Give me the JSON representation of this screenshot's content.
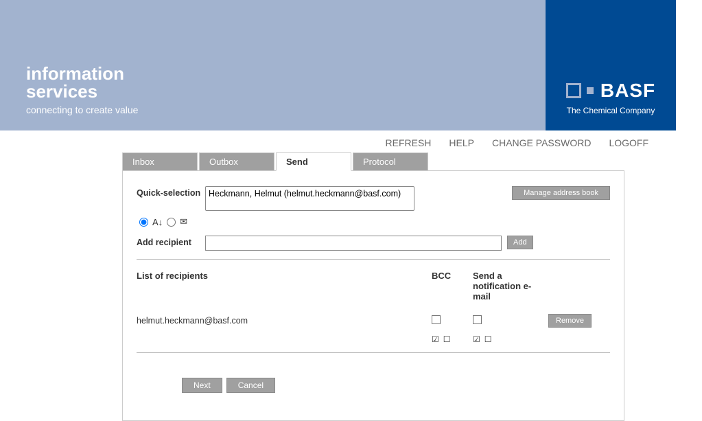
{
  "header": {
    "logo_line1a": "information",
    "logo_line1b": "services",
    "logo_tagline": "connecting to create value",
    "brand": "BASF",
    "brand_tagline": "The Chemical Company"
  },
  "topnav": {
    "refresh": "REFRESH",
    "help": "HELP",
    "change_password": "CHANGE PASSWORD",
    "logoff": "LOGOFF"
  },
  "tabs": {
    "inbox": "Inbox",
    "outbox": "Outbox",
    "send": "Send",
    "protocol": "Protocol"
  },
  "panel": {
    "quick_label": "Quick-selection",
    "quick_option": "Heckmann, Helmut (helmut.heckmann@basf.com)",
    "manage_btn": "Manage address book",
    "add_label": "Add recipient",
    "add_btn": "Add",
    "list_header": "List of recipients",
    "bcc_header": "BCC",
    "notif_header": "Send a notification e-mail",
    "recipient_email": "helmut.heckmann@basf.com",
    "remove_btn": "Remove",
    "next_btn": "Next",
    "cancel_btn": "Cancel"
  }
}
